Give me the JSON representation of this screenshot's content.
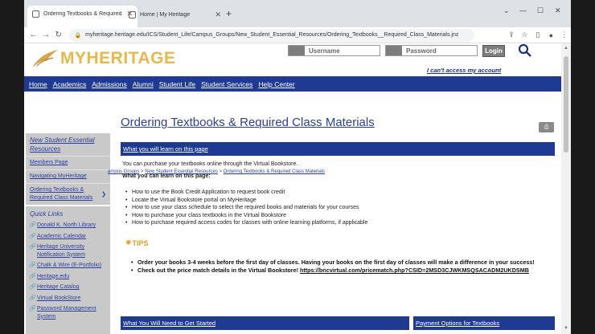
{
  "browser": {
    "tabs": [
      {
        "title": "Ordering Textbooks & Required"
      },
      {
        "title": "Home | My Heritage"
      }
    ],
    "url": "myheritage.heritage.edu/ICS/Student_Life/Campus_Groups/New_Student_Essential_Resources/Ordering_Textbooks__Required_Class_Materials.jnz"
  },
  "header": {
    "brand": "MYHERITAGE",
    "username_placeholder": "Username",
    "password_placeholder": "Password",
    "login_label": "Login",
    "cant_access": "I can't access my account"
  },
  "nav": [
    "Home",
    "Academics",
    "Admissions",
    "Alumni",
    "Student Life",
    "Student Services",
    "Help Center"
  ],
  "sidebar": {
    "group": "New Student Essential Resources",
    "items": [
      "Members Page",
      "Navigating MyHeritage",
      "Ordering Textbooks & Required Class Materials"
    ],
    "quick_links_heading": "Quick Links",
    "quick_links": [
      "Donald K. North Library",
      "Academic Calendar",
      "Heritage University Notification System",
      "Chalk & Wire (E-Portfolio)",
      "Heritage.edu",
      "Heritage Catalog",
      "Virtual BookStore",
      "Password Management System"
    ]
  },
  "main": {
    "title": "Ordering Textbooks & Required Class Materials",
    "learn_bar": "What you will learn on this page",
    "intro": "You can purchase your textbooks online through the Virtual Bookstore.",
    "breadcrumb": [
      "ampus Groups",
      "New Student Essential Resources",
      "Ordering Textbooks & Required Class Materials"
    ],
    "learn_heading": "What you can learn on this page:",
    "learn_items": [
      "How to use the Book Credit Application to request book credit",
      "Locate the Virtual Bookstore portal on MyHeritage",
      "How to use your class schedule to select the required books and materials for your courses",
      "How to purchase your class textbooks in the Virtual Bookstore",
      "How to purchase required access codes for classes with online learning platforms, if applicable"
    ],
    "tips_label": "TIPS",
    "tip1": "Order your books 3-4 weeks before the first day of classes. Having your books on the first day of classes will make a difference in your success!",
    "tip2_prefix": "Check out the price match details in the Virtual Bookstore! ",
    "tip2_link": "https://bncvirtual.com/pricematch.php?CSID=2MSD3CJWKMSQSACADM2UKDSMB",
    "bottom_bar_left": "What You Will Need to Get Started",
    "bottom_bar_right": "Payment Options for Textbooks"
  },
  "colors": {
    "nav_blue": "#1f3a93",
    "brand_gold": "#e8b84a",
    "link_blue": "#2b3fa0"
  }
}
